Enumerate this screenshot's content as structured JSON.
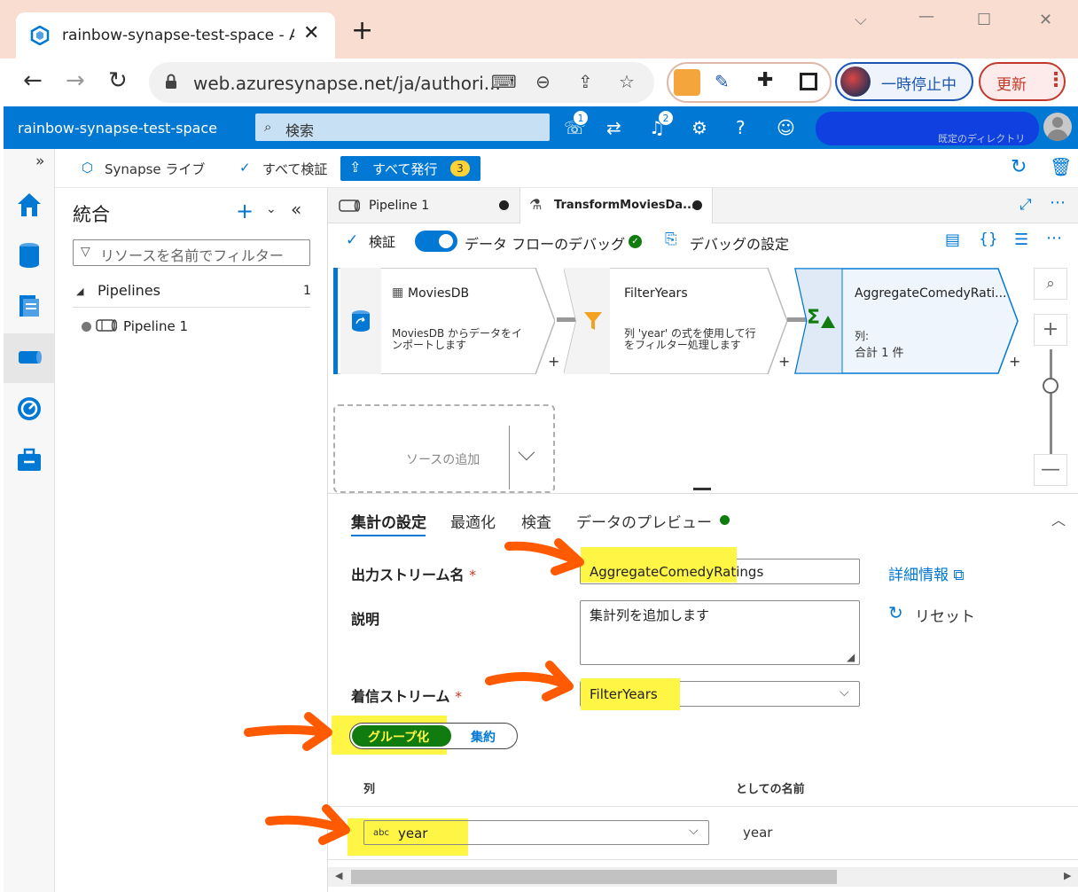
{
  "browser": {
    "tab_title": "rainbow-synapse-test-space - Az",
    "url": "web.azuresynapse.net/ja/authori...",
    "profile_label": "一時停止中",
    "update_label": "更新"
  },
  "azure": {
    "workspace": "rainbow-synapse-test-space",
    "search_placeholder": "検索",
    "feedback_badge": "1",
    "notifications_badge": "2",
    "account_text": "既定のディレクトリ"
  },
  "command_bar": {
    "live_label": "Synapse ライブ",
    "validate_all": "すべて検証",
    "publish_all": "すべて発行",
    "publish_count": "3"
  },
  "resources": {
    "title": "統合",
    "filter_placeholder": "リソースを名前でフィルター",
    "section": "Pipelines",
    "section_count": "1",
    "items": [
      "Pipeline 1"
    ]
  },
  "editor_tabs": [
    {
      "label": "Pipeline 1"
    },
    {
      "label": "TransformMoviesDa..."
    }
  ],
  "dataflow_toolbar": {
    "validate": "検証",
    "debug": "データ フローのデバッグ",
    "debug_settings": "デバッグの設定"
  },
  "canvas": {
    "nodes": [
      {
        "name": "MoviesDB",
        "desc": "MoviesDB からデータをインポートします"
      },
      {
        "name": "FilterYears",
        "desc": "列 'year' の式を使用して行をフィルター処理します"
      },
      {
        "name": "AggregateComedyRati...",
        "desc_label": "列:",
        "desc": "合計 1 件"
      }
    ],
    "add_source": "ソースの追加"
  },
  "settings": {
    "tabs": [
      "集計の設定",
      "最適化",
      "検査",
      "データのプレビュー"
    ],
    "output_stream_label": "出力ストリーム名",
    "output_stream_value": "AggregateComedyRatings",
    "details_link": "詳細情報",
    "description_label": "説明",
    "description_value": "集計列を追加します",
    "reset_label": "リセット",
    "incoming_label": "着信ストリーム",
    "incoming_value": "FilterYears",
    "toggle_group": "グループ化",
    "toggle_aggregate": "集約",
    "col_header": "列",
    "alias_header": "としての名前",
    "row_type": "abc",
    "row_column": "year",
    "row_alias": "year"
  },
  "colors": {
    "azure_blue": "#0078d4",
    "highlight": "#fff544",
    "arrow": "#ff5a00",
    "group_green": "#107c10"
  }
}
